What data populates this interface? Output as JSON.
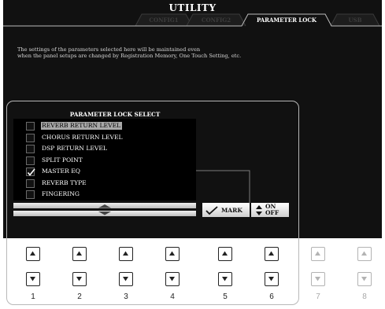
{
  "header": {
    "title": "UTILITY",
    "tabs": [
      {
        "label": "CONFIG1",
        "active": false
      },
      {
        "label": "CONFIG2",
        "active": false
      },
      {
        "label": "PARAMETER LOCK",
        "active": true
      },
      {
        "label": "USB",
        "active": false
      }
    ]
  },
  "message": {
    "line1": "The settings of the parameters selected here will be maintained even",
    "line2": "when the panel setups are changed by Registration Memory, One Touch Setting, etc."
  },
  "lock_select": {
    "header": "PARAMETER LOCK SELECT",
    "items": [
      {
        "label": "REVERB RETURN LEVEL",
        "checked": false,
        "highlighted": true
      },
      {
        "label": "CHORUS RETURN LEVEL",
        "checked": false,
        "highlighted": false
      },
      {
        "label": "DSP RETURN LEVEL",
        "checked": false,
        "highlighted": false
      },
      {
        "label": "SPLIT POINT",
        "checked": false,
        "highlighted": false
      },
      {
        "label": "MASTER EQ",
        "checked": true,
        "highlighted": false
      },
      {
        "label": "REVERB TYPE",
        "checked": false,
        "highlighted": false
      },
      {
        "label": "FINGERING",
        "checked": false,
        "highlighted": false
      }
    ]
  },
  "controls": {
    "mark_label": "MARK",
    "on_label": "ON",
    "off_label": "OFF"
  },
  "buttons": {
    "numbers": [
      "1",
      "2",
      "3",
      "4",
      "5",
      "6",
      "7",
      "8"
    ]
  },
  "colors": {
    "screen_bg": "#111111",
    "highlight": "#a8a8a8",
    "frame": "#b8b8b8"
  }
}
